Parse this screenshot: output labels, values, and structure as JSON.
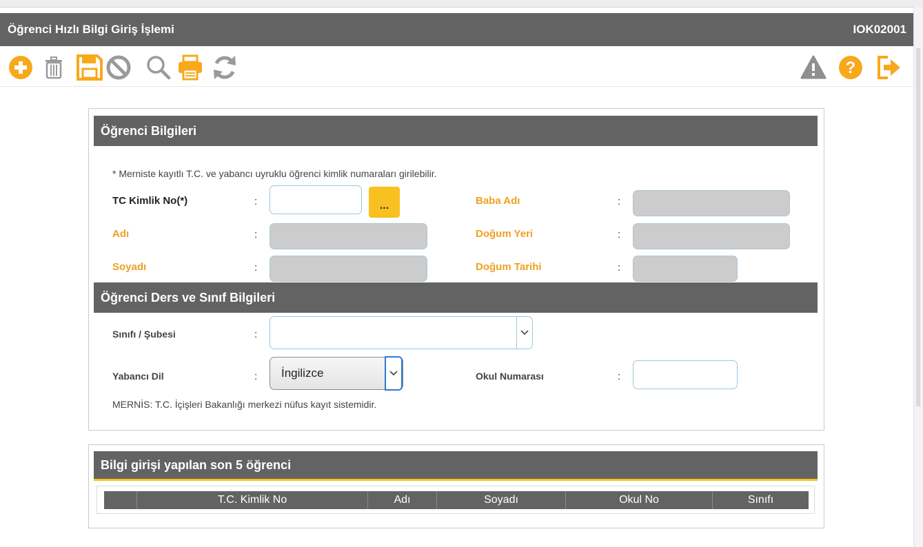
{
  "page": {
    "title": "Öğrenci Hızlı Bilgi Giriş İşlemi",
    "code": "IOK02001"
  },
  "toolbar": {
    "left_icons": [
      "add-icon",
      "trash-icon",
      "save-icon",
      "cancel-icon",
      "search-icon",
      "print-icon",
      "refresh-icon"
    ],
    "right_icons": [
      "warning-icon",
      "help-icon",
      "exit-icon"
    ]
  },
  "student_info": {
    "heading": "Öğrenci Bilgileri",
    "note": "* Merniste kayıtlı T.C. ve yabancı uyruklu öğrenci kimlik numaraları girilebilir.",
    "tc_label": "TC Kimlik No(*)",
    "tc_value": "",
    "lookup_label": "...",
    "name_label": "Adı",
    "surname_label": "Soyadı",
    "father_label": "Baba Adı",
    "birthplace_label": "Doğum Yeri",
    "birthdate_label": "Doğum Tarihi",
    "colon": ":"
  },
  "course_info": {
    "heading": "Öğrenci Ders ve Sınıf Bilgileri",
    "class_label": "Sınıfı / Şubesi",
    "class_value": "",
    "language_label": "Yabancı Dil",
    "language_value": "İngilizce",
    "school_no_label": "Okul Numarası",
    "school_no_value": "",
    "footnote": "MERNİS: T.C. İçişleri Bakanlığı merkezi nüfus kayıt sistemidir."
  },
  "recent": {
    "heading": "Bilgi girişi yapılan son 5 öğrenci",
    "columns": [
      "",
      "T.C. Kimlik No",
      "Adı",
      "Soyadı",
      "Okul No",
      "Sınıfı"
    ]
  },
  "colors": {
    "header_bg": "#636363",
    "accent_orange": "#f8a81b",
    "label_orange": "#f0a020",
    "icon_grey": "#9a9a9a"
  }
}
